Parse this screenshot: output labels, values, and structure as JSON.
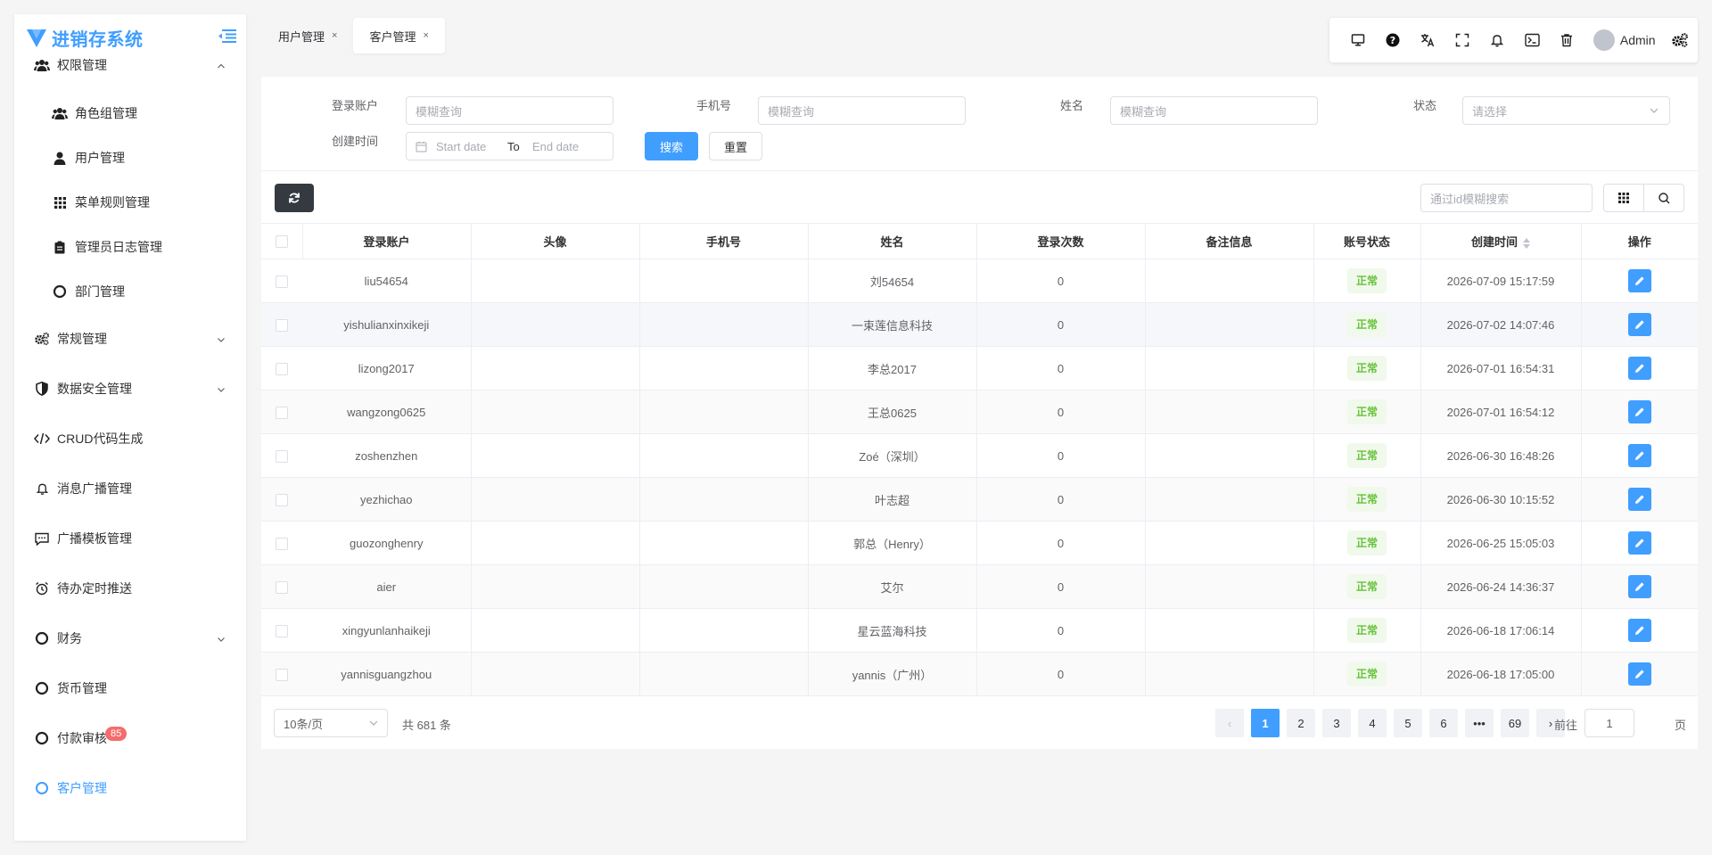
{
  "app": {
    "title": "进销存系统"
  },
  "sidebar": {
    "items": [
      {
        "label": "权限管理",
        "icon": "users-icon",
        "level": "top",
        "expanded": true
      },
      {
        "label": "角色组管理",
        "icon": "users-icon",
        "level": "sub"
      },
      {
        "label": "用户管理",
        "icon": "user-icon",
        "level": "sub"
      },
      {
        "label": "菜单规则管理",
        "icon": "grid-icon",
        "level": "sub"
      },
      {
        "label": "管理员日志管理",
        "icon": "clipboard-icon",
        "level": "sub"
      },
      {
        "label": "部门管理",
        "icon": "circle-icon",
        "level": "sub"
      },
      {
        "label": "常规管理",
        "icon": "gears-icon",
        "level": "top",
        "expandable": true
      },
      {
        "label": "数据安全管理",
        "icon": "shield-icon",
        "level": "top",
        "expandable": true
      },
      {
        "label": "CRUD代码生成",
        "icon": "code-icon",
        "level": "top"
      },
      {
        "label": "消息广播管理",
        "icon": "bell-icon",
        "level": "top"
      },
      {
        "label": "广播模板管理",
        "icon": "message-icon",
        "level": "top"
      },
      {
        "label": "待办定时推送",
        "icon": "alarm-icon",
        "level": "top"
      },
      {
        "label": "财务",
        "icon": "circle-icon",
        "level": "top",
        "expandable": true
      },
      {
        "label": "货币管理",
        "icon": "circle-icon",
        "level": "top"
      },
      {
        "label": "付款审核",
        "icon": "circle-icon",
        "level": "top",
        "badge": "85"
      },
      {
        "label": "客户管理",
        "icon": "circle-icon",
        "level": "top",
        "active": true
      }
    ]
  },
  "tabs": [
    {
      "label": "用户管理",
      "close": "×"
    },
    {
      "label": "客户管理",
      "close": "×",
      "active": true
    }
  ],
  "toolbar": {
    "user_name": "Admin"
  },
  "filter": {
    "account_label": "登录账户",
    "account_placeholder": "模糊查询",
    "phone_label": "手机号",
    "phone_placeholder": "模糊查询",
    "name_label": "姓名",
    "name_placeholder": "模糊查询",
    "status_label": "状态",
    "status_placeholder": "请选择",
    "created_label": "创建时间",
    "start_placeholder": "Start date",
    "range_sep": "To",
    "end_placeholder": "End date",
    "search_label": "搜索",
    "reset_label": "重置"
  },
  "table_tools": {
    "id_search_placeholder": "通过id模糊搜索"
  },
  "table": {
    "columns": [
      "登录账户",
      "头像",
      "手机号",
      "姓名",
      "登录次数",
      "备注信息",
      "账号状态",
      "创建时间",
      "操作"
    ],
    "rows": [
      {
        "account": "liu54654",
        "avatar": "",
        "phone": "",
        "name": "刘54654",
        "logins": "0",
        "remark": "",
        "status": "正常",
        "created": "2026-07-09 15:17:59"
      },
      {
        "account": "yishulianxinxikeji",
        "avatar": "",
        "phone": "",
        "name": "一束莲信息科技",
        "logins": "0",
        "remark": "",
        "status": "正常",
        "created": "2026-07-02 14:07:46"
      },
      {
        "account": "lizong2017",
        "avatar": "",
        "phone": "",
        "name": "李总2017",
        "logins": "0",
        "remark": "",
        "status": "正常",
        "created": "2026-07-01 16:54:31"
      },
      {
        "account": "wangzong0625",
        "avatar": "",
        "phone": "",
        "name": "王总0625",
        "logins": "0",
        "remark": "",
        "status": "正常",
        "created": "2026-07-01 16:54:12"
      },
      {
        "account": "zoshenzhen",
        "avatar": "",
        "phone": "",
        "name": "Zoé（深圳）",
        "logins": "0",
        "remark": "",
        "status": "正常",
        "created": "2026-06-30 16:48:26"
      },
      {
        "account": "yezhichao",
        "avatar": "",
        "phone": "",
        "name": "叶志超",
        "logins": "0",
        "remark": "",
        "status": "正常",
        "created": "2026-06-30 10:15:52"
      },
      {
        "account": "guozonghenry",
        "avatar": "",
        "phone": "",
        "name": "郭总（Henry）",
        "logins": "0",
        "remark": "",
        "status": "正常",
        "created": "2026-06-25 15:05:03"
      },
      {
        "account": "aier",
        "avatar": "",
        "phone": "",
        "name": "艾尔",
        "logins": "0",
        "remark": "",
        "status": "正常",
        "created": "2026-06-24 14:36:37"
      },
      {
        "account": "xingyunlanhaikeji",
        "avatar": "",
        "phone": "",
        "name": "星云蓝海科技",
        "logins": "0",
        "remark": "",
        "status": "正常",
        "created": "2026-06-18 17:06:14"
      },
      {
        "account": "yannisguangzhou",
        "avatar": "",
        "phone": "",
        "name": "yannis（广州）",
        "logins": "0",
        "remark": "",
        "status": "正常",
        "created": "2026-06-18 17:05:00"
      }
    ]
  },
  "pagination": {
    "page_size": "10条/页",
    "total": "共 681 条",
    "pages": [
      "1",
      "2",
      "3",
      "4",
      "5",
      "6",
      "•••",
      "69"
    ],
    "current": "1",
    "goto_label": "前往",
    "goto_value": "1",
    "goto_suffix": "页"
  },
  "colors": {
    "primary": "#409eff",
    "success": "#67c23a",
    "danger": "#f56c6c",
    "dark": "#343a40"
  }
}
